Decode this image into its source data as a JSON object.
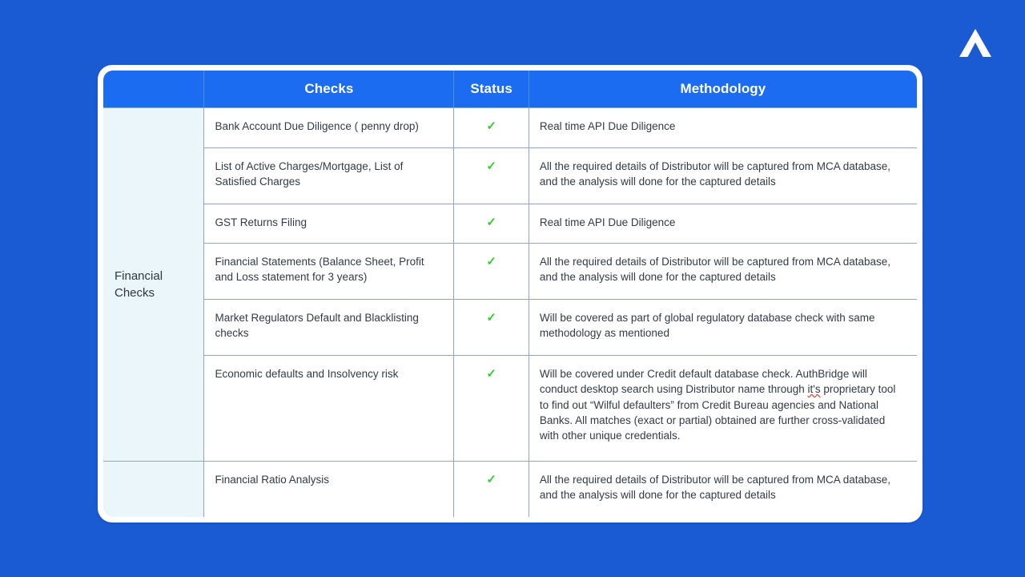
{
  "theme": {
    "page_background": "#1a5bd4",
    "header_blue": "#1b6cf0",
    "group_cell_background": "#eaf6fa",
    "border_color": "#8fa5cc",
    "check_green": "#2fd132",
    "card_background": "#ffffff",
    "text_color": "#333a45"
  },
  "logo": {
    "name": "authbridge-chevron-logo",
    "color": "#ffffff"
  },
  "table": {
    "headers": {
      "group": "",
      "checks": "Checks",
      "status": "Status",
      "methodology": "Methodology"
    },
    "group_label": "Financial Checks",
    "status_symbol": "✓",
    "rows": [
      {
        "check": "Bank Account Due Diligence ( penny drop)",
        "status": "✓",
        "methodology": "Real time API Due Diligence"
      },
      {
        "check": "List of Active Charges/Mortgage, List of Satisfied Charges",
        "status": "✓",
        "methodology": "All the required details of Distributor will be captured from MCA database, and the analysis will done for the captured details"
      },
      {
        "check": "GST Returns Filing",
        "status": "✓",
        "methodology": "Real time API Due Diligence"
      },
      {
        "check": "Financial Statements (Balance Sheet, Profit and Loss statement for 3 years)",
        "status": "✓",
        "methodology": "All the required details of Distributor will be captured from MCA database, and the analysis will done for the captured details"
      },
      {
        "check": "Market Regulators Default and Blacklisting checks",
        "status": "✓",
        "methodology": "Will be covered as part of global regulatory database check with same methodology as mentioned"
      },
      {
        "check": "Economic defaults and Insolvency risk",
        "status": "✓",
        "methodology_parts": {
          "before": "Will be covered under Credit default database check. AuthBridge will conduct desktop search using Distributor name through ",
          "misspelled": "it's",
          "after": " proprietary tool to find out “Wilful defaulters” from Credit Bureau agencies and National Banks. All matches (exact or partial) obtained are further cross-validated with other unique credentials."
        }
      },
      {
        "check": "Financial Ratio Analysis",
        "status": "✓",
        "methodology": "All the required details of Distributor will be captured from MCA database, and the analysis will done for the captured details"
      }
    ]
  }
}
